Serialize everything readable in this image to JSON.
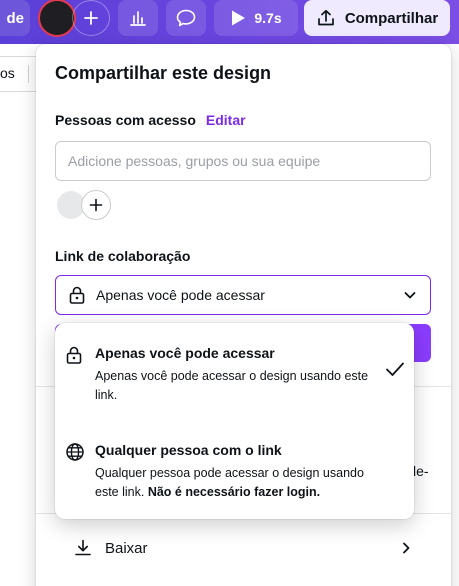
{
  "toolbar": {
    "left_partial_label": "de",
    "play_duration": "9.7s",
    "share_label": "Compartilhar"
  },
  "background": {
    "tab_fragment": "os",
    "right_fragment": "le-"
  },
  "share_panel": {
    "title": "Compartilhar este design",
    "people_label": "Pessoas com acesso",
    "edit_link": "Editar",
    "people_input_placeholder": "Adicione pessoas, grupos ou sua equipe",
    "collab_label": "Link de colaboração",
    "access_selected": "Apenas você pode acessar",
    "download_label": "Baixar"
  },
  "access_menu": {
    "options": [
      {
        "title": "Apenas você pode acessar",
        "description": "Apenas você pode acessar o design usando este link.",
        "selected": true
      },
      {
        "title": "Qualquer pessoa com o link",
        "description": "Qualquer pessoa pode acessar o design usando este link.",
        "description_bold": "Não é necessário fazer login.",
        "selected": false
      }
    ]
  },
  "colors": {
    "toolbar_purple": "#6b45e0",
    "accent_purple": "#7d2ae8",
    "button_purple": "#8b3dff",
    "avatar_ring": "#e53a4d"
  },
  "icons": [
    "plus-icon",
    "bar-chart-icon",
    "comment-icon",
    "play-icon",
    "upload-icon",
    "lock-icon",
    "chevron-down-icon",
    "check-icon",
    "globe-icon",
    "download-icon",
    "chevron-right-icon"
  ]
}
